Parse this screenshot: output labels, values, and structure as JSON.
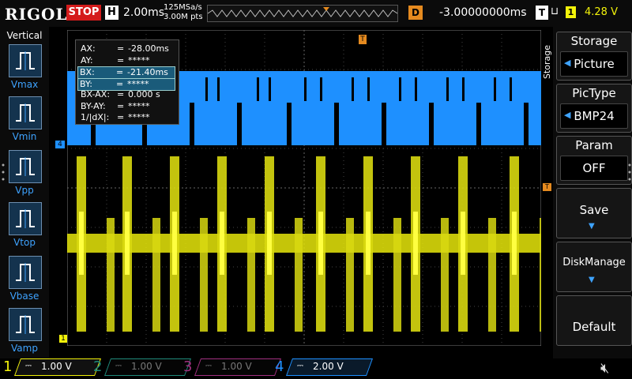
{
  "topbar": {
    "brand": "RIGOL",
    "run_state": "STOP",
    "horiz_label": "H",
    "timebase": "2.00ms",
    "sample_rate": "125MSa/s",
    "points": "3.00M pts",
    "delay_label": "D",
    "delay": "-3.00000000ms",
    "trig_label": "T",
    "trig_slope": "⊔",
    "trig_channel": "1",
    "trig_level": "4.28 V"
  },
  "measure_panel": {
    "title": "Vertical",
    "items": [
      {
        "label": "Vmax",
        "icon": "vmax-icon"
      },
      {
        "label": "Vmin",
        "icon": "vmin-icon"
      },
      {
        "label": "Vpp",
        "icon": "vpp-icon"
      },
      {
        "label": "Vtop",
        "icon": "vtop-icon"
      },
      {
        "label": "Vbase",
        "icon": "vbase-icon"
      },
      {
        "label": "Vamp",
        "icon": "vamp-icon"
      }
    ]
  },
  "cursor_readout": {
    "rows": [
      {
        "key": "AX:",
        "eq": "=",
        "value": "-28.00ms"
      },
      {
        "key": "AY:",
        "eq": "=",
        "value": "*****"
      },
      {
        "key": "BX:",
        "eq": "=",
        "value": "-21.40ms"
      },
      {
        "key": "BY:",
        "eq": "=",
        "value": "*****"
      },
      {
        "key": "BX-AX:",
        "eq": "=",
        "value": "0.000 s"
      },
      {
        "key": "BY-AY:",
        "eq": "=",
        "value": "*****"
      },
      {
        "key": "1/|dX|:",
        "eq": "=",
        "value": "*****"
      }
    ]
  },
  "softkeys": {
    "side_label": "Storage",
    "storage_title": "Storage",
    "storage_value": "Picture",
    "pictype_title": "PicType",
    "pictype_value": "BMP24",
    "param_title": "Param",
    "param_value": "OFF",
    "save_label": "Save",
    "diskmanage_label": "DiskManage",
    "default_label": "Default"
  },
  "markers": {
    "ch4_marker": "4",
    "trig_top": "T",
    "trig_level_marker": "T",
    "ch1_marker": "1"
  },
  "channels": [
    {
      "num": "1",
      "coupling": "⎓",
      "scale": "1.00 V",
      "color": "#f2f20a",
      "active": true
    },
    {
      "num": "2",
      "coupling": "⎓",
      "scale": "1.00 V",
      "color": "#1f8a7a",
      "active": false
    },
    {
      "num": "3",
      "coupling": "⎓",
      "scale": "1.00 V",
      "color": "#a0307f",
      "active": false
    },
    {
      "num": "4",
      "coupling": "⎓",
      "scale": "2.00 V",
      "color": "#1e90ff",
      "active": true
    }
  ],
  "colors": {
    "ch1": "#f2f20a",
    "ch4": "#1e90ff",
    "trigger": "#e58a1f",
    "stop": "#d41b1b"
  }
}
